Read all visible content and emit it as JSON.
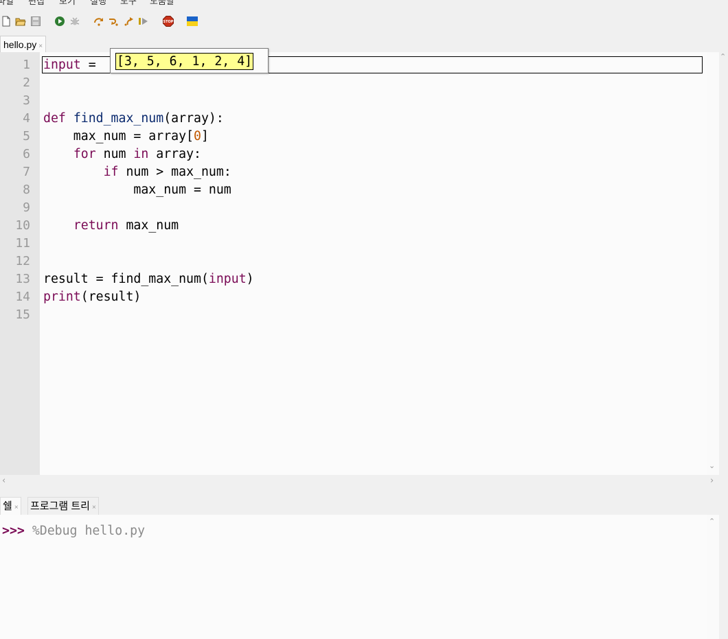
{
  "menu": {
    "items": [
      "파일",
      "편집",
      "보기",
      "실행",
      "도구",
      "도움말"
    ]
  },
  "toolbar": {
    "buttons": [
      {
        "name": "new-file-icon"
      },
      {
        "name": "open-folder-icon"
      },
      {
        "name": "save-icon"
      },
      {
        "name": "run-icon"
      },
      {
        "name": "debug-bug-icon"
      },
      {
        "name": "step-over-icon"
      },
      {
        "name": "step-into-icon"
      },
      {
        "name": "step-out-icon"
      },
      {
        "name": "resume-icon"
      },
      {
        "name": "stop-icon",
        "label": "STOP"
      },
      {
        "name": "ukraine-flag-icon"
      }
    ]
  },
  "editor": {
    "tab": {
      "label": "hello.py",
      "close": "×"
    },
    "line_numbers": [
      "1",
      "2",
      "3",
      "4",
      "5",
      "6",
      "7",
      "8",
      "9",
      "10",
      "11",
      "12",
      "13",
      "14",
      "15"
    ],
    "lines": [
      [
        {
          "t": "input",
          "c": "builtin"
        },
        {
          "t": " = ",
          "c": ""
        }
      ],
      [],
      [],
      [
        {
          "t": "def",
          "c": "kw"
        },
        {
          "t": " ",
          "c": ""
        },
        {
          "t": "find_max_num",
          "c": "fn"
        },
        {
          "t": "(array):",
          "c": ""
        }
      ],
      [
        {
          "t": "    max_num = array[",
          "c": ""
        },
        {
          "t": "0",
          "c": "num"
        },
        {
          "t": "]",
          "c": ""
        }
      ],
      [
        {
          "t": "    ",
          "c": ""
        },
        {
          "t": "for",
          "c": "kw"
        },
        {
          "t": " num ",
          "c": ""
        },
        {
          "t": "in",
          "c": "kw"
        },
        {
          "t": " array:",
          "c": ""
        }
      ],
      [
        {
          "t": "        ",
          "c": ""
        },
        {
          "t": "if",
          "c": "kw"
        },
        {
          "t": " num > max_num:",
          "c": ""
        }
      ],
      [
        {
          "t": "            max_num = num",
          "c": ""
        }
      ],
      [],
      [
        {
          "t": "    ",
          "c": ""
        },
        {
          "t": "return",
          "c": "kw"
        },
        {
          "t": " max_num",
          "c": ""
        }
      ],
      [],
      [],
      [
        {
          "t": "result = find_max_num(",
          "c": ""
        },
        {
          "t": "input",
          "c": "builtin"
        },
        {
          "t": ")",
          "c": ""
        }
      ],
      [
        {
          "t": "print",
          "c": "builtin"
        },
        {
          "t": "(result)",
          "c": ""
        }
      ],
      []
    ],
    "debug_value": "[3, 5, 6, 1, 2, 4]"
  },
  "bottom_tabs": [
    {
      "label": "쉘",
      "close": "×"
    },
    {
      "label": "프로그램 트리",
      "close": "×"
    }
  ],
  "shell": {
    "prompt": ">>>",
    "command": "%Debug hello.py"
  },
  "colors": {
    "keyword": "#7a0a55",
    "function_name": "#0b2a6e",
    "number": "#c05800",
    "debug_highlight": "#ffff90",
    "gutter": "#e6e6e6"
  }
}
